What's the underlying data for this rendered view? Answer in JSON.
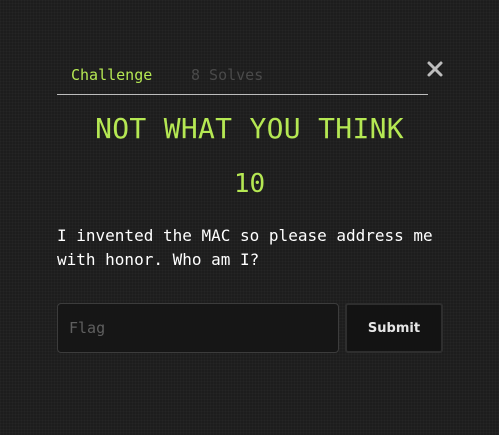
{
  "modal": {
    "tabs": [
      {
        "label": "Challenge",
        "active": true
      },
      {
        "label": "8 Solves",
        "active": false
      }
    ],
    "close_icon": "close-icon",
    "title": "NOT WHAT YOU THINK",
    "points": "10",
    "description": "I invented the MAC so please address me with honor. Who am I?",
    "flag_input": {
      "placeholder": "Flag",
      "value": ""
    },
    "submit_label": "Submit"
  },
  "colors": {
    "accent": "#b5e853",
    "background": "#1d1d1d",
    "muted_tab": "#4a4a4a",
    "divider": "#bdbdbd"
  }
}
